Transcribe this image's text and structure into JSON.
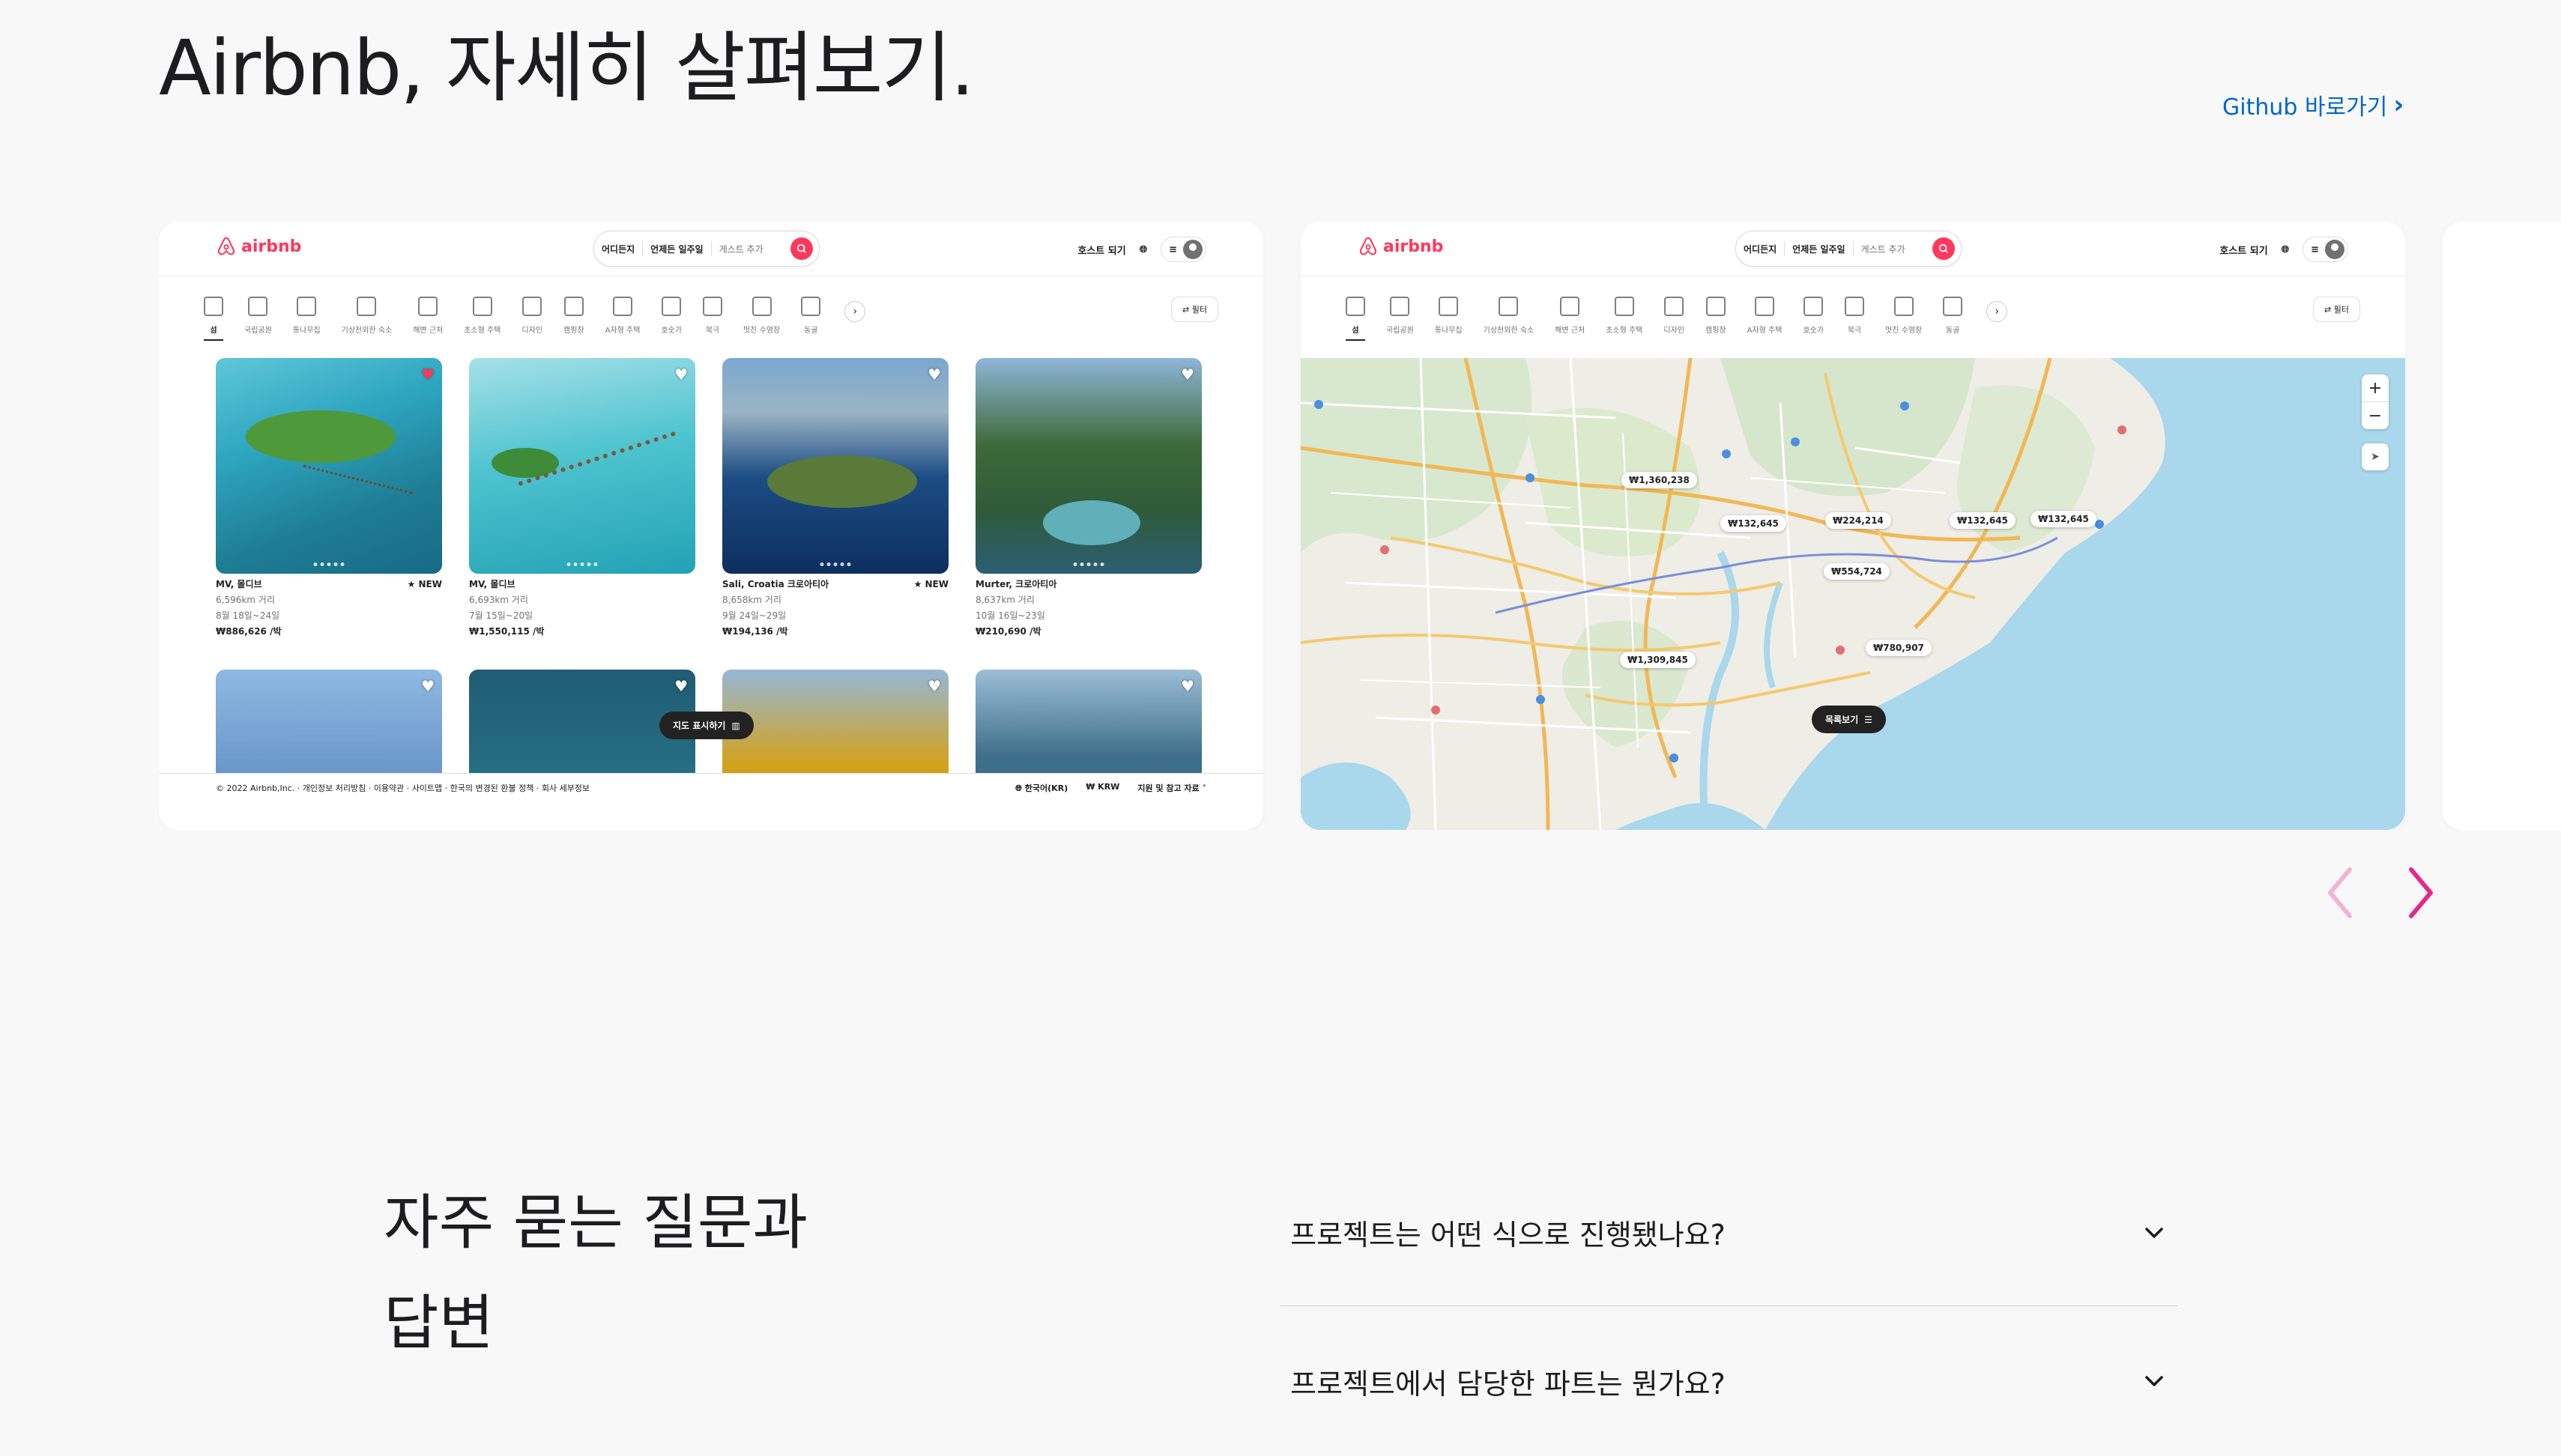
{
  "hero": {
    "title": "Airbnb, 자세히 살펴보기.",
    "github_label": "Github 바로가기",
    "github_chevron": "›"
  },
  "colors": {
    "accent_pink": "#e5298b",
    "accent_pink_faded": "#f2b3d3",
    "airbnb_red": "#ff385c",
    "link_blue": "#0066cc"
  },
  "slide_listing": {
    "logo": "airbnb",
    "search": {
      "where": "어디든지",
      "when": "언제든 일주일",
      "guests": "게스트 추가"
    },
    "host_label": "호스트 되기",
    "categories": [
      "섬",
      "국립공원",
      "통나무집",
      "기상천외한 숙소",
      "해변 근처",
      "초소형 주택",
      "디자인",
      "캠핑장",
      "A자형 주택",
      "호숫가",
      "북극",
      "멋진 수영장",
      "동굴"
    ],
    "filter_label": "필터",
    "listings": [
      {
        "title": "MV, 몰디브",
        "badge": "★ NEW",
        "distance": "6,596km 거리",
        "dates": "8월 18일~24일",
        "price": "₩886,626 /박",
        "liked": true
      },
      {
        "title": "MV, 몰디브",
        "badge": "",
        "distance": "6,693km 거리",
        "dates": "7월 15일~20일",
        "price": "₩1,550,115 /박",
        "liked": false
      },
      {
        "title": "Sali, Croatia 크로아티아",
        "badge": "★ NEW",
        "distance": "8,658km 거리",
        "dates": "9월 24일~29일",
        "price": "₩194,136 /박",
        "liked": false
      },
      {
        "title": "Murter, 크로아티아",
        "badge": "",
        "distance": "8,637km 거리",
        "dates": "10월 16일~23일",
        "price": "₩210,690 /박",
        "liked": false
      }
    ],
    "map_toggle": "지도 표시하기",
    "footer_left": "© 2022 Airbnb,Inc. · 개인정보 처리방침 · 이용약관 · 사이트맵 · 한국의 변경된 환불 정책 · 회사 세부정보",
    "footer_lang": "한국어(KR)",
    "footer_currency": "₩ KRW",
    "footer_support": "지원 및 참고 자료"
  },
  "slide_map": {
    "logo": "airbnb",
    "search": {
      "where": "어디든지",
      "when": "언제든 일주일",
      "guests": "게스트 추가"
    },
    "host_label": "호스트 되기",
    "filter_label": "필터",
    "prices": [
      "₩1,360,238",
      "₩132,645",
      "₩224,214",
      "₩132,645",
      "₩132,645",
      "₩554,724",
      "₩780,907",
      "₩1,309,845"
    ],
    "list_toggle": "목록보기",
    "zoom_in": "+",
    "zoom_out": "−"
  },
  "faq": {
    "title_line1": "자주 묻는 질문과",
    "title_line2": "답변",
    "items": [
      {
        "question": "프로젝트는 어떤 식으로 진행됐나요?"
      },
      {
        "question": "프로젝트에서 담당한 파트는 뭔가요?"
      }
    ]
  }
}
